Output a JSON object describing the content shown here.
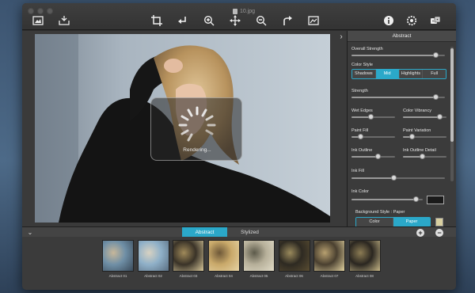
{
  "window": {
    "title": "10.jpg"
  },
  "toolbar": {
    "buttons": [
      {
        "name": "browse-icon",
        "label": ""
      },
      {
        "name": "save-icon",
        "label": ""
      },
      {
        "name": "crop-icon",
        "label": ""
      },
      {
        "name": "undo-icon",
        "label": ""
      },
      {
        "name": "zoom-in-icon",
        "label": ""
      },
      {
        "name": "pan-icon",
        "label": ""
      },
      {
        "name": "zoom-out-icon",
        "label": ""
      },
      {
        "name": "redo-icon",
        "label": ""
      },
      {
        "name": "compare-icon",
        "label": ""
      },
      {
        "name": "info-icon",
        "label": ""
      },
      {
        "name": "settings-icon",
        "label": ""
      },
      {
        "name": "presets-icon",
        "label": ""
      }
    ]
  },
  "canvas": {
    "rendering_text": "Rendering..."
  },
  "panel": {
    "header": "Abstract",
    "overall_strength": {
      "label": "Overall Strength",
      "value": 0.9
    },
    "color_style": {
      "label": "Color Style",
      "options": [
        "Shadows",
        "Mid",
        "Highlights",
        "Full"
      ],
      "selected": "Mid"
    },
    "strength": {
      "label": "Strength",
      "value": 0.9
    },
    "wet_edges": {
      "label": "Wet Edges",
      "value": 0.45
    },
    "color_vibrancy": {
      "label": "Color Vibrancy",
      "value": 0.85
    },
    "paint_fill": {
      "label": "Paint Fill",
      "value": 0.2
    },
    "paint_variation": {
      "label": "Paint Variation",
      "value": 0.2
    },
    "ink_outline": {
      "label": "Ink Outline",
      "value": 0.6
    },
    "ink_outline_detail": {
      "label": "Ink Outline Detail",
      "value": 0.45
    },
    "ink_fill": {
      "label": "Ink Fill",
      "value": 0.45
    },
    "ink_color": {
      "label": "Ink Color",
      "value": 0.9,
      "swatch": "#1a1a1a"
    },
    "background_style": {
      "label": "Background Style : Paper",
      "options": [
        "Color",
        "Paper"
      ],
      "selected": "Paper"
    }
  },
  "bottom": {
    "tabs": [
      "Abstract",
      "Stylized"
    ],
    "active_tab": "Abstract",
    "add_label": "+",
    "remove_label": "−",
    "thumbnails": [
      {
        "label": "Abstract 01",
        "colors": [
          "#6f8fa6",
          "#c7b79a",
          "#3b4b5a"
        ]
      },
      {
        "label": "Abstract 02",
        "colors": [
          "#8fb0c8",
          "#d8d2c2",
          "#5b6f82"
        ]
      },
      {
        "label": "Abstract 03",
        "colors": [
          "#3a3328",
          "#a08a5a",
          "#d7c79a"
        ]
      },
      {
        "label": "Abstract 04",
        "colors": [
          "#c9a96a",
          "#6e5838",
          "#e6d3a4"
        ]
      },
      {
        "label": "Abstract 05",
        "colors": [
          "#b7b09a",
          "#5c5a4a",
          "#e0dbc8"
        ]
      },
      {
        "label": "Abstract 06",
        "colors": [
          "#2e2a22",
          "#9a8a5c",
          "#5a4d32"
        ]
      },
      {
        "label": "Abstract 07",
        "colors": [
          "#4a4030",
          "#b7a070",
          "#e2d2a0"
        ]
      },
      {
        "label": "Abstract 08",
        "colors": [
          "#2a2620",
          "#8c7c54",
          "#c8b888"
        ]
      }
    ]
  },
  "colors": {
    "accent": "#2ba8c9"
  }
}
